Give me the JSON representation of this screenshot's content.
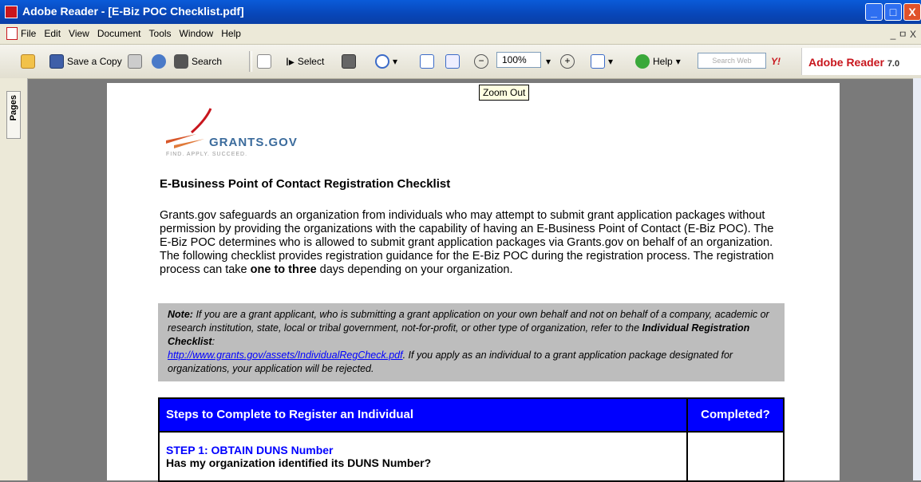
{
  "window": {
    "title": "Adobe Reader - [E-Biz POC Checklist.pdf]",
    "minimize": "_",
    "maximize": "□",
    "close": "X"
  },
  "menu": {
    "items": [
      "File",
      "Edit",
      "View",
      "Document",
      "Tools",
      "Window",
      "Help"
    ],
    "doc_controls": "_ ㅁ X"
  },
  "toolbar": {
    "save_copy": "Save a Copy",
    "search": "Search",
    "select": "Select",
    "zoom_value": "100%",
    "help": "Help",
    "search_web_placeholder": "Search Web",
    "yahoo": "Y!",
    "reader_label": "Adobe Reader",
    "reader_version": "7.0"
  },
  "tooltip": "Zoom Out",
  "sidebar": {
    "pages_tab": "Pages"
  },
  "document": {
    "logo_text": "GRANTS.GOV",
    "logo_tag": "FIND. APPLY. SUCCEED.",
    "heading": "E-Business Point of Contact Registration Checklist",
    "paragraph_main": "Grants.gov safeguards an organization from individuals who may attempt to submit grant application packages without permission by providing the organizations with the capability of having an E-Business Point of Contact (E-Biz POC). The E-Biz POC determines who is allowed to submit grant application packages via Grants.gov on behalf of an organization. The following checklist provides registration guidance for the E-Biz POC during the registration process. The registration process can take",
    "paragraph_bold": "one to three",
    "paragraph_tail": "days depending on your organization.",
    "note_label": "Note:",
    "note_text_1": "If you are a grant applicant, who is submitting a grant application on your own behalf and not on behalf of a company, academic or research institution, state, local or tribal government, not-for-profit, or other type of organization, refer to the",
    "note_bold": "Individual Registration Checklist",
    "note_colon": ":",
    "note_link": "http://www.grants.gov/assets/IndividualRegCheck.pdf",
    "note_text_2": ". If you apply as an individual to a grant application package designated for organizations, your application will be rejected.",
    "table_header_1": "Steps to Complete to Register an Individual",
    "table_header_2": "Completed?",
    "step1_title": "STEP 1: OBTAIN DUNS Number",
    "step1_question": "Has my organization identified its DUNS Number?"
  }
}
